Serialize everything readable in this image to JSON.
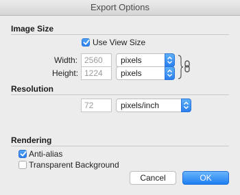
{
  "window": {
    "title": "Export Options"
  },
  "image_size": {
    "heading": "Image Size",
    "use_view_size": {
      "label": "Use View Size",
      "checked": true
    },
    "width": {
      "label": "Width:",
      "value": "2560",
      "unit": "pixels"
    },
    "height": {
      "label": "Height:",
      "value": "1224",
      "unit": "pixels"
    },
    "link_icon": "chain-link-icon"
  },
  "resolution": {
    "heading": "Resolution",
    "value": "72",
    "unit": "pixels/inch"
  },
  "rendering": {
    "heading": "Rendering",
    "anti_alias": {
      "label": "Anti-alias",
      "checked": true
    },
    "transparent_background": {
      "label": "Transparent Background",
      "checked": false
    }
  },
  "buttons": {
    "cancel": "Cancel",
    "ok": "OK"
  },
  "colors": {
    "accent": "#2a7ff0",
    "background": "#ececec"
  }
}
